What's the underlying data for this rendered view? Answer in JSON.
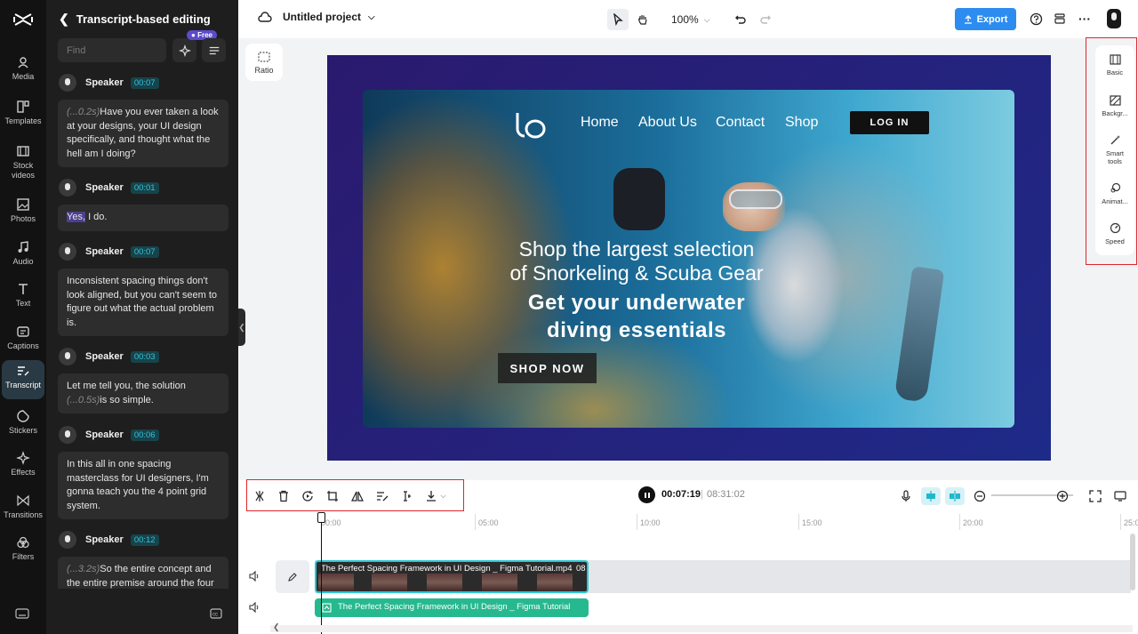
{
  "rail": {
    "items": [
      {
        "label": "Media"
      },
      {
        "label": "Templates"
      },
      {
        "label": "Stock videos"
      },
      {
        "label": "Photos"
      },
      {
        "label": "Audio"
      },
      {
        "label": "Text"
      },
      {
        "label": "Captions"
      },
      {
        "label": "Transcript"
      },
      {
        "label": "Stickers"
      },
      {
        "label": "Effects"
      },
      {
        "label": "Transitions"
      },
      {
        "label": "Filters"
      }
    ]
  },
  "panel": {
    "title": "Transcript-based editing",
    "find_placeholder": "Find",
    "free_badge": "Free",
    "segments": [
      {
        "speaker": "Speaker",
        "time": "00:07",
        "pause": "(...0.2s)",
        "text": "Have you ever taken a look at your designs, your UI design specifically, and thought what the hell am I doing?"
      },
      {
        "speaker": "Speaker",
        "time": "00:01",
        "highlight": "Yes,",
        "text": " I do."
      },
      {
        "speaker": "Speaker",
        "time": "00:07",
        "text": "Inconsistent spacing things don't look aligned, but you can't seem to figure out what the actual problem is."
      },
      {
        "speaker": "Speaker",
        "time": "00:03",
        "text": "Let me tell you, the solution ",
        "pause": "(...0.5s)",
        "text2": "is so simple."
      },
      {
        "speaker": "Speaker",
        "time": "00:06",
        "text": "In this all in one spacing masterclass for UI designers, I'm gonna teach you the 4 point grid system."
      },
      {
        "speaker": "Speaker",
        "time": "00:12",
        "pause": "(...3.2s)",
        "text": "So the entire concept and the entire premise around the four"
      }
    ]
  },
  "topbar": {
    "project_name": "Untitled project",
    "zoom": "100%",
    "export_label": "Export"
  },
  "canvas": {
    "ratio_label": "Ratio",
    "site": {
      "nav": [
        "Home",
        "About Us",
        "Contact",
        "Shop"
      ],
      "login": "LOG IN",
      "hero_line1": "Shop the largest selection",
      "hero_line2": "of Snorkeling & Scuba Gear",
      "hero_bold1": "Get your underwater",
      "hero_bold2": "diving essentials",
      "cta": "SHOP NOW"
    }
  },
  "props": {
    "items": [
      {
        "label": "Basic"
      },
      {
        "label": "Backgr..."
      },
      {
        "label": "Smart tools"
      },
      {
        "label": "Animat..."
      },
      {
        "label": "Speed"
      }
    ]
  },
  "timeline": {
    "current_time": "00:07:19",
    "separator": "|",
    "total_time": "08:31:02",
    "ticks": [
      "00:00",
      "05:00",
      "10:00",
      "15:00",
      "20:00",
      "25:0"
    ],
    "video_clip_title": "The Perfect Spacing Framework in UI Design _ Figma Tutorial.mp4",
    "video_clip_duration": "08",
    "audio_clip_title": "The Perfect Spacing Framework in UI Design _ Figma Tutorial"
  },
  "colors": {
    "accent": "#2d8cf0",
    "teal": "#28c8d6",
    "audio_green": "#26b98f",
    "highlight_red": "#e0262b"
  }
}
